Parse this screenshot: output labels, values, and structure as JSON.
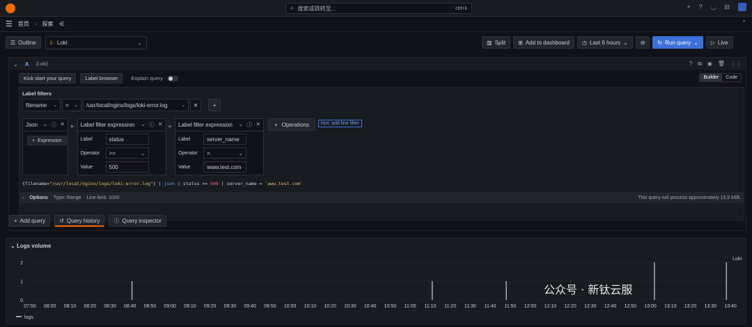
{
  "topbar": {
    "search_placeholder": "搜索或跳转至...",
    "search_shortcut": "ctrl+k",
    "plus": "+"
  },
  "breadcrumb": {
    "home": "首页",
    "sep": "›",
    "explore": "探索"
  },
  "toolbar": {
    "outline": "Outline",
    "datasource": "Loki",
    "split": "Split",
    "add_to_dashboard": "Add to dashboard",
    "time_range": "Last 6 hours",
    "run_query": "Run query",
    "live": "Live"
  },
  "query": {
    "ref_id": "A",
    "datasource_note": "(Loki)",
    "kick_start": "Kick start your query",
    "label_browser": "Label browser",
    "explain": "Explain query",
    "builder": "Builder",
    "code": "Code",
    "label_filters_title": "Label filters",
    "label_filter": {
      "label": "filename",
      "op": "=",
      "value": "/usr/local/nginx/logs/loki-error.log"
    },
    "ops": [
      {
        "name": "Json",
        "action": "Expression"
      },
      {
        "name": "Label filter expression",
        "label_text": "Label",
        "operator_text": "Operator",
        "value_text": "Value",
        "label": "status",
        "operator": ">=",
        "value": "500"
      },
      {
        "name": "Label filter expression",
        "label_text": "Label",
        "operator_text": "Operator",
        "value_text": "Value",
        "label": "server_name",
        "operator": "=",
        "value": "www.test.com"
      }
    ],
    "operations_btn": "Operations",
    "hint": "hint: add line filter",
    "query_text": {
      "p1": "{filename=",
      "p2": "\"/usr/local/nginx/logs/loki-error.log\"",
      "p3": "} | ",
      "p4": "json",
      "p5": " | status >= ",
      "p6": "500",
      "p7": " | server_name = ",
      "p8": "`www.test.com`"
    },
    "options": {
      "label": "Options",
      "type": "Type: Range",
      "limit": "Line limit: 1000",
      "note": "This query will process approximately 15.9 MiB."
    }
  },
  "bottom": {
    "add_query": "Add query",
    "query_history": "Query history",
    "query_inspector": "Query inspector"
  },
  "logs_volume": {
    "title": "Logs volume",
    "chart_data": {
      "type": "bar",
      "series": [
        {
          "name": "logs",
          "color": "#9fa7b3",
          "values_at": [
            {
              "x": "08:41",
              "y": 1
            },
            {
              "x": "11:11",
              "y": 1
            },
            {
              "x": "11:48",
              "y": 1
            },
            {
              "x": "13:02",
              "y": 2
            },
            {
              "x": "13:38",
              "y": 2
            }
          ]
        }
      ],
      "x_ticks": [
        "07:50",
        "08:00",
        "08:10",
        "08:20",
        "08:30",
        "08:40",
        "08:50",
        "09:00",
        "09:10",
        "09:20",
        "09:30",
        "09:40",
        "09:50",
        "10:00",
        "10:10",
        "10:20",
        "10:30",
        "10:40",
        "10:50",
        "11:00",
        "11:10",
        "11:20",
        "11:30",
        "11:40",
        "11:50",
        "12:00",
        "12:10",
        "12:20",
        "12:30",
        "12:40",
        "12:50",
        "13:00",
        "13:10",
        "13:20",
        "13:30",
        "13:40"
      ],
      "y_ticks": [
        "0",
        "1",
        "2"
      ],
      "ylim": [
        0,
        2
      ],
      "series_label_right": "Loki",
      "legend": "logs"
    }
  },
  "watermark": "公众号 · 新钛云服"
}
